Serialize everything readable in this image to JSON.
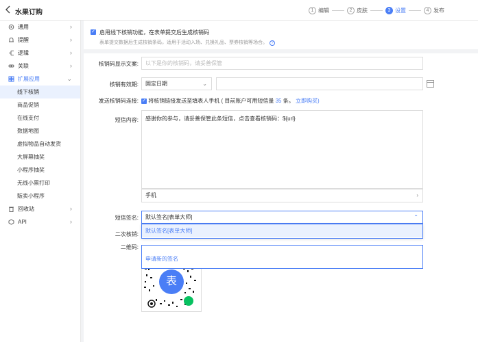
{
  "header": {
    "back_icon": "chevron-left-icon",
    "title": "水果订购",
    "steps": [
      {
        "num": "1",
        "label": "编辑"
      },
      {
        "num": "2",
        "label": "皮肤"
      },
      {
        "num": "3",
        "label": "设置"
      },
      {
        "num": "4",
        "label": "发布"
      }
    ],
    "active_step": 3
  },
  "sidebar": {
    "items": [
      {
        "label": "通用",
        "icon": "gear-icon"
      },
      {
        "label": "提醒",
        "icon": "bell-icon"
      },
      {
        "label": "逻辑",
        "icon": "logic-icon"
      },
      {
        "label": "关联",
        "icon": "link-icon"
      },
      {
        "label": "扩展应用",
        "icon": "apps-icon"
      }
    ],
    "sub_items": [
      "线下核销",
      "商品促销",
      "在线支付",
      "数据地图",
      "虚拟物品自动发货",
      "大屏幕抽奖",
      "小程序抽奖",
      "无线小票打印",
      "販卖小程序"
    ],
    "bottom_items": [
      {
        "label": "回收站",
        "icon": "trash-icon"
      },
      {
        "label": "API",
        "icon": "api-icon"
      }
    ]
  },
  "notice": {
    "checkbox_checked": true,
    "line1": "启用线下核销功能，在表单提交后生成核销码",
    "line2": "表单提交数据后生成核销条码，适用于活动入场、兑换礼品、票券核销等场合。"
  },
  "form": {
    "display_text_label": "核销码显示文案:",
    "display_text_placeholder": "以下是你的核销码，请妥善保管",
    "validity_label": "核销有效期:",
    "validity_value": "固定日期",
    "send_label": "发送核销码连接:",
    "send_text_pre": "将核销链接发送至填表人手机",
    "send_text_mid": "( 目前账户可用短信量",
    "send_count": "35",
    "send_text_post": "条。",
    "send_link": "立即购买)",
    "sms_label": "短信内容:",
    "sms_content": "感谢你的参与，请妥善保管此条短信，点击查看核销码：${url}",
    "phone_value": "手机",
    "signature_label": "短信签名:",
    "signature_value": "默认签名[表单大师]",
    "second_label": "二次核销:",
    "qr_label": "二维码:",
    "dropdown_option": "默认签名[表单大师]",
    "new_signature": "申请新的签名",
    "qr_center": "表"
  }
}
